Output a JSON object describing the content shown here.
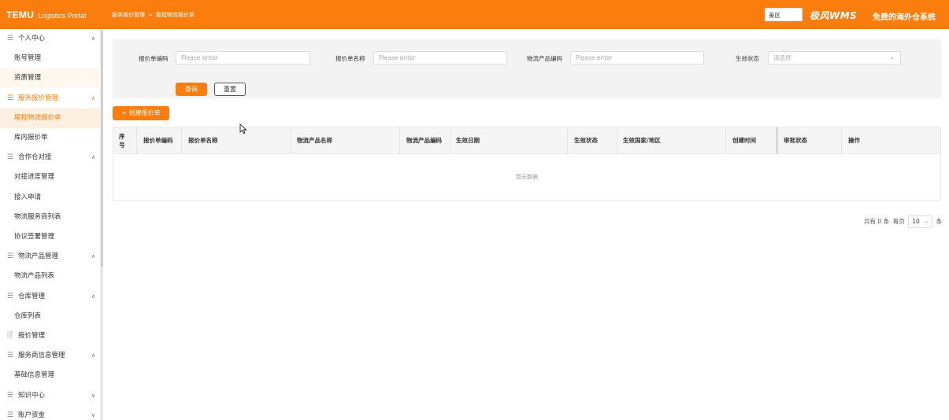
{
  "header": {
    "logo": "TEMU",
    "app_name": "Logistics Portal",
    "breadcrumb": [
      "服务报价管理",
      "尾程物流报价单"
    ],
    "region": "美区",
    "partner_logo": "极风WMS",
    "partner_tagline": "免费的海外仓系统"
  },
  "sidebar": {
    "groups": [
      {
        "label": "个人中心",
        "icon": "menu-icon",
        "expanded": true,
        "items": [
          "账号管理",
          "资质管理"
        ]
      },
      {
        "label": "服务报价管理",
        "icon": "menu-icon",
        "expanded": true,
        "active": true,
        "items": [
          "尾程物流报价单",
          "库内报价单"
        ]
      },
      {
        "label": "合作仓对接",
        "icon": "menu-icon",
        "expanded": true,
        "items": [
          "对接进度管理",
          "接入申请",
          "物流服务商列表",
          "协议签署管理"
        ]
      },
      {
        "label": "物流产品管理",
        "icon": "menu-icon",
        "expanded": true,
        "items": [
          "物流产品列表"
        ]
      },
      {
        "label": "仓库管理",
        "icon": "menu-icon",
        "expanded": true,
        "items": [
          "仓库列表"
        ]
      },
      {
        "label": "报价管理",
        "icon": "document-icon",
        "expanded": false,
        "items": []
      },
      {
        "label": "服务商信息管理",
        "icon": "menu-icon",
        "expanded": true,
        "items": [
          "基础信息管理"
        ]
      },
      {
        "label": "知识中心",
        "icon": "menu-icon",
        "expanded": false,
        "items": []
      },
      {
        "label": "账户资金",
        "icon": "menu-icon",
        "expanded": false,
        "items": []
      }
    ],
    "active_item": "尾程物流报价单"
  },
  "filters": {
    "fields": [
      {
        "label": "报价单编码",
        "placeholder": "Please enter"
      },
      {
        "label": "报价单名称",
        "placeholder": "Please enter"
      },
      {
        "label": "物流产品编码",
        "placeholder": "Please enter"
      },
      {
        "label": "生效状态",
        "placeholder": "请选择"
      }
    ],
    "query_button": "查询",
    "reset_button": "重置"
  },
  "create_button": "+ 创建报价单",
  "table": {
    "columns": [
      "序号",
      "报价单编码",
      "报价单名称",
      "物流产品名称",
      "物流产品编码",
      "生效日期",
      "生效状态",
      "生效国家/地区",
      "创建时间",
      "审批状态",
      "操作"
    ],
    "empty_text": "暂无数据"
  },
  "pagination": {
    "total_prefix": "共有",
    "total": "0",
    "total_suffix": "条",
    "per_page_label": "每页",
    "page_size": "10",
    "page_size_unit": "条"
  }
}
